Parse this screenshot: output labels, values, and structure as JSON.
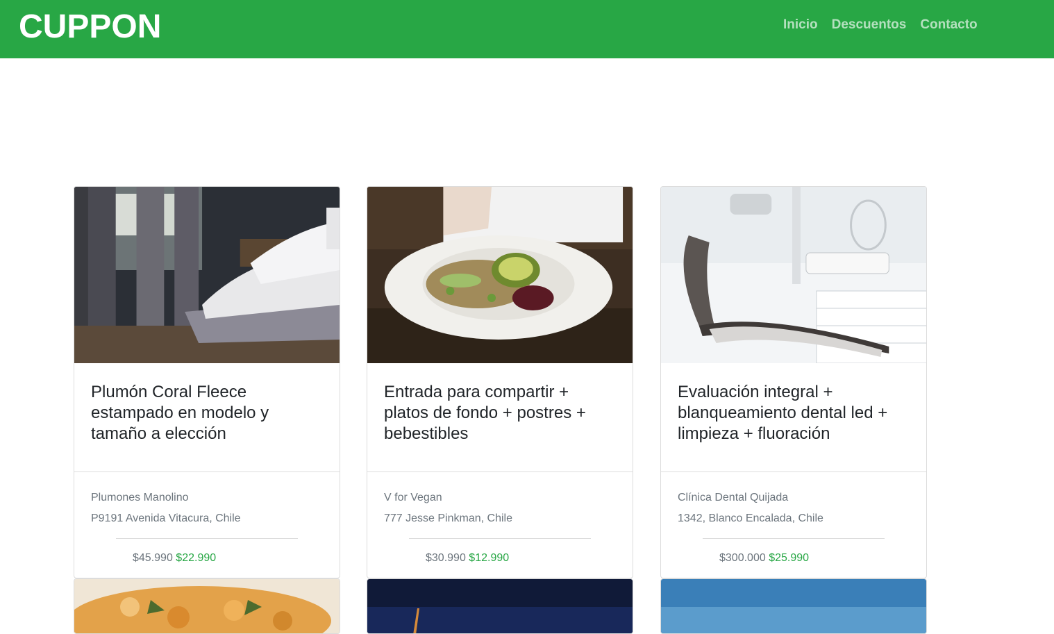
{
  "navbar": {
    "brand": "CUPPON",
    "links": [
      "Inicio",
      "Descuentos",
      "Contacto"
    ],
    "color": "#28a745"
  },
  "deals": [
    {
      "title": "Plumón Coral Fleece estampado en modelo y tamaño a elección",
      "merchant": "Plumones Manolino",
      "address": "P9191 Avenida Vitacura, Chile",
      "price_old": "$45.990",
      "price_new": "$22.990",
      "image": "bedroom-photo"
    },
    {
      "title": "Entrada para compartir + platos de fondo + postres + bebestibles",
      "merchant": "V for Vegan",
      "address": "777 Jesse Pinkman, Chile",
      "price_old": "$30.990",
      "price_new": "$12.990",
      "image": "vegan-bowl-photo"
    },
    {
      "title": "Evaluación integral + blanqueamiento dental led + limpieza + fluoración",
      "merchant": "Clínica Dental Quijada",
      "address": "1342, Blanco Encalada, Chile",
      "price_old": "$300.000",
      "price_new": "$25.990",
      "image": "dental-chair-photo"
    }
  ],
  "bottom_cards": [
    "food-photo",
    "night-sky-photo",
    "blue-sky-photo"
  ]
}
